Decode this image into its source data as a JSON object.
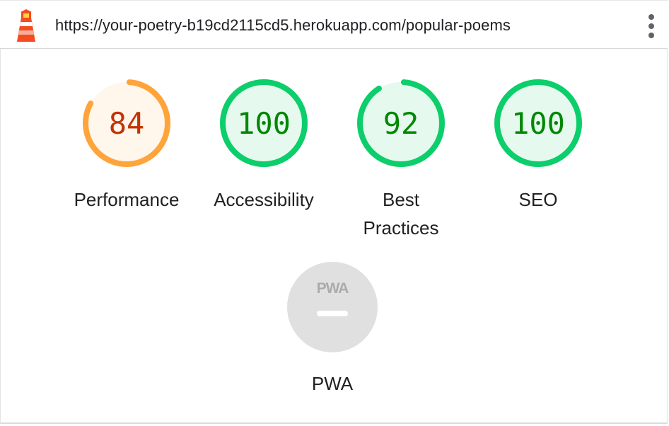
{
  "header": {
    "url": "https://your-poetry-b19cd2115cd5.herokuapp.com/popular-poems",
    "logo_icon": "lighthouse-icon",
    "menu_icon": "more-vertical-icon"
  },
  "categories": [
    {
      "score": "84",
      "label": "Performance",
      "fraction": 0.84,
      "color": "#ffa43b",
      "fill": "#fff6ec",
      "text_color": "#c33300"
    },
    {
      "score": "100",
      "label": "Accessibility",
      "fraction": 1.0,
      "color": "#0cce6b",
      "fill": "#e6f9ef",
      "text_color": "#008800"
    },
    {
      "score": "92",
      "label": "Best Practices",
      "label_lines": [
        "Best",
        "Practices"
      ],
      "fraction": 0.92,
      "color": "#0cce6b",
      "fill": "#e6f9ef",
      "text_color": "#008800"
    },
    {
      "score": "100",
      "label": "SEO",
      "fraction": 1.0,
      "color": "#0cce6b",
      "fill": "#e6f9ef",
      "text_color": "#008800"
    }
  ],
  "pwa": {
    "badge_text": "PWA",
    "label": "PWA",
    "fill": "#e0e0e0"
  }
}
